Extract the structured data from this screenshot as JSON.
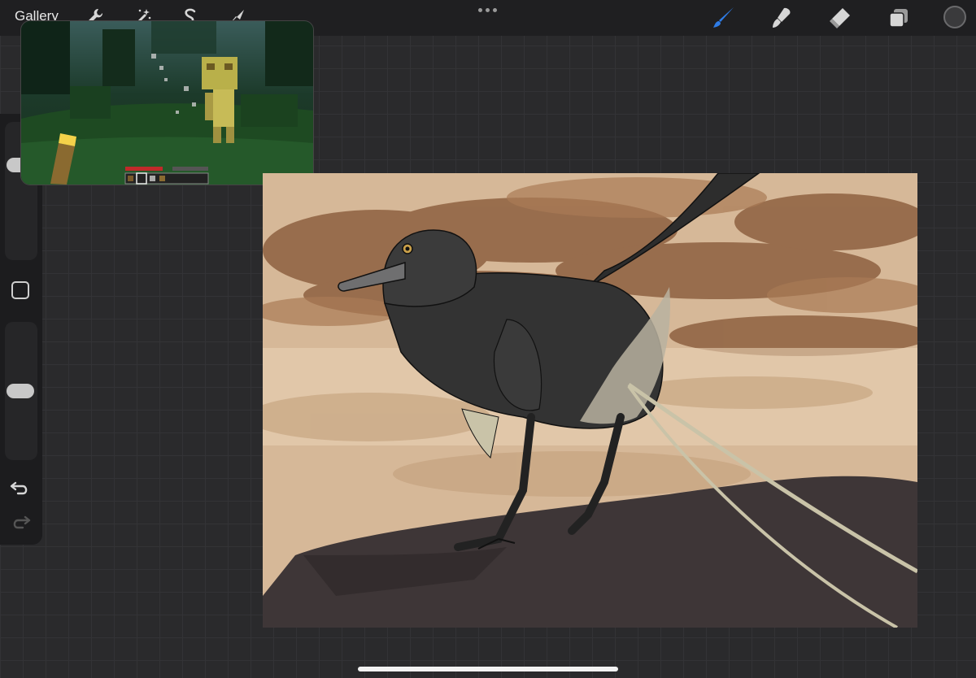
{
  "topbar": {
    "gallery_label": "Gallery",
    "left_tools": [
      "wrench-icon",
      "magic-wand-icon",
      "selection-icon",
      "transform-arrow-icon"
    ],
    "right_tools": [
      "brush-icon",
      "smudge-icon",
      "eraser-icon",
      "layers-icon"
    ],
    "active_tool": "brush-icon",
    "active_color": "#2f7ce6",
    "color_well": "#3a3a3c"
  },
  "sidebar": {
    "brush_size_level": 0.72,
    "opacity_level": 0.5,
    "icons": [
      "modify-square-icon",
      "undo-icon",
      "redo-icon"
    ]
  },
  "pip": {
    "content": "minecraft-gameplay-video",
    "icons": [
      "torch-icon",
      "health-hearts-icon",
      "hotbar-icon"
    ]
  },
  "canvas": {
    "artwork": "feathered-dinosaur-painting",
    "palette": [
      "#d7b897",
      "#8a5e3b",
      "#3d3636",
      "#2b2b2b",
      "#c9c3a8",
      "#c9a96e"
    ]
  }
}
